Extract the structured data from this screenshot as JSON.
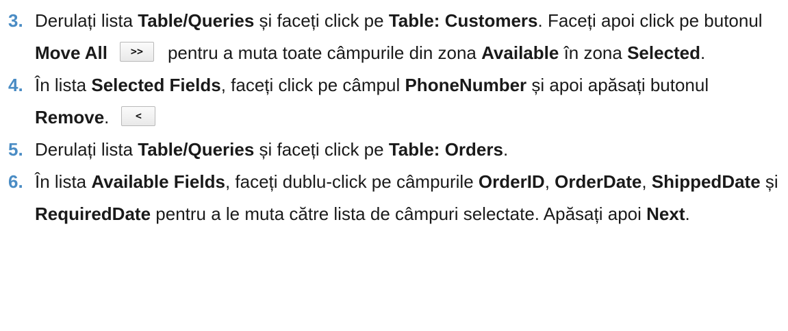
{
  "steps": [
    {
      "number": "3.",
      "parts": [
        "Derulați lista ",
        "Table/Queries",
        " și faceți click pe ",
        "Table: Customers",
        ". Faceți apoi click pe butonul ",
        "Move All",
        "pentru a muta toate câmpurile din zona ",
        "Available",
        " în zona ",
        "Selected",
        "."
      ],
      "button_label": ">>"
    },
    {
      "number": "4.",
      "parts": [
        "În lista ",
        "Selected Fields",
        ", faceți click pe câmpul ",
        "PhoneNumber",
        " și apoi apăsați butonul ",
        "Remove",
        "."
      ],
      "button_label": "<"
    },
    {
      "number": "5.",
      "parts": [
        "Derulați lista ",
        "Table/Queries",
        " și faceți click pe ",
        "Table: Orders",
        "."
      ]
    },
    {
      "number": "6.",
      "parts": [
        "În lista ",
        "Available Fields",
        ", faceți dublu-click pe câmpurile ",
        "OrderID",
        ", ",
        "OrderDate",
        ", ",
        "ShippedDate",
        " și ",
        "RequiredDate",
        " pentru a le muta către lista de câmpuri selectate. Apăsați apoi ",
        "Next",
        "."
      ]
    }
  ],
  "colors": {
    "step_number": "#4a8cc4",
    "text": "#1a1a1a"
  }
}
